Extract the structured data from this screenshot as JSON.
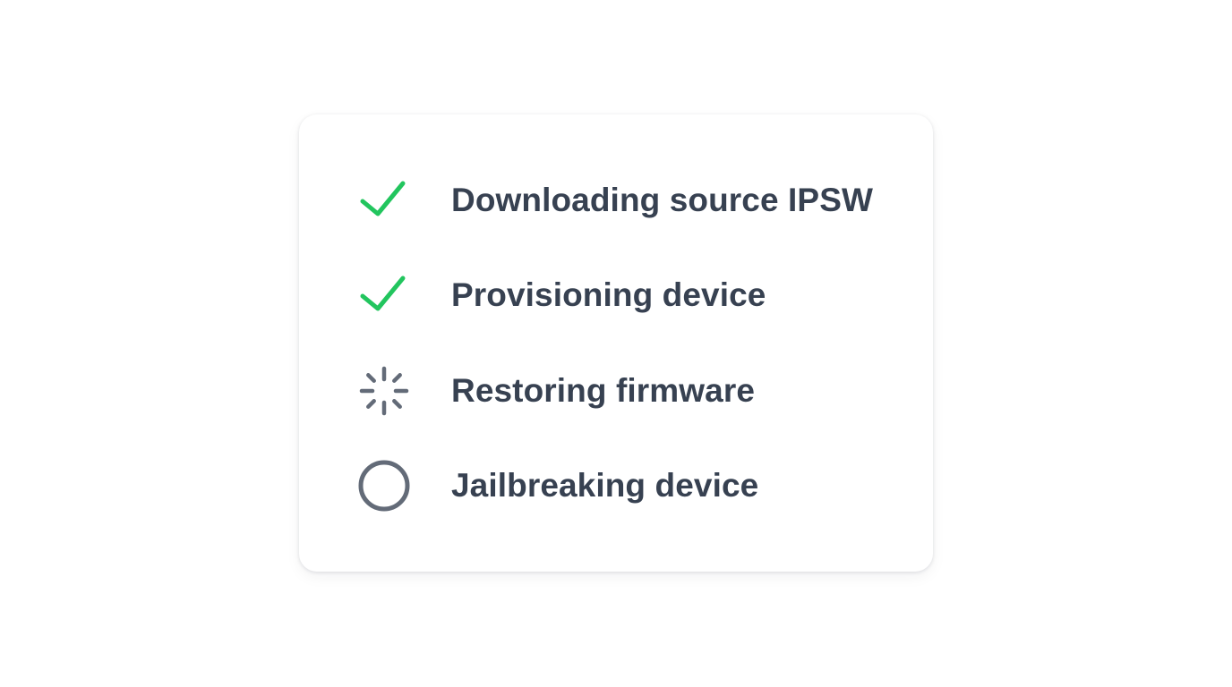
{
  "colors": {
    "done": "#22c55e",
    "in_progress": "#636b78",
    "pending": "#636b78",
    "label": "#374151"
  },
  "steps": [
    {
      "label": "Downloading source IPSW",
      "status": "done",
      "icon": "checkmark-icon"
    },
    {
      "label": "Provisioning device",
      "status": "done",
      "icon": "checkmark-icon"
    },
    {
      "label": "Restoring firmware",
      "status": "in-progress",
      "icon": "spinner-icon"
    },
    {
      "label": "Jailbreaking device",
      "status": "pending",
      "icon": "empty-circle-icon"
    }
  ]
}
